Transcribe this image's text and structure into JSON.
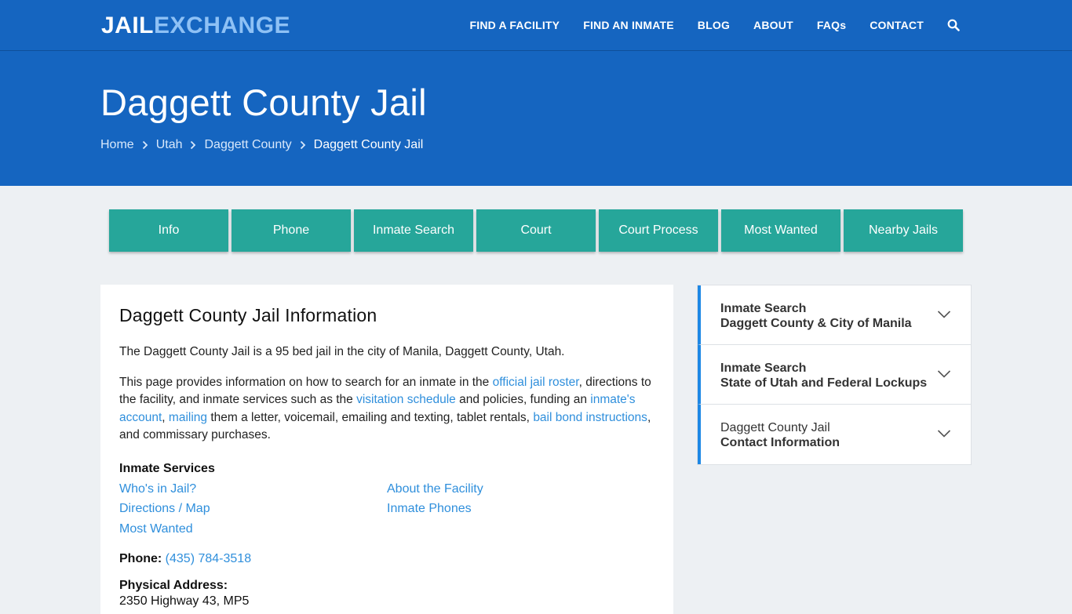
{
  "header": {
    "logo_part1": "JAIL",
    "logo_part2": "EXCHANGE",
    "nav": [
      "FIND A FACILITY",
      "FIND AN INMATE",
      "BLOG",
      "ABOUT",
      "FAQs",
      "CONTACT"
    ]
  },
  "hero": {
    "title": "Daggett County Jail",
    "breadcrumbs": [
      "Home",
      "Utah",
      "Daggett County",
      "Daggett County Jail"
    ]
  },
  "tabs": [
    "Info",
    "Phone",
    "Inmate Search",
    "Court",
    "Court Process",
    "Most Wanted",
    "Nearby Jails"
  ],
  "main": {
    "heading": "Daggett County Jail Information",
    "intro": "The Daggett County Jail is a 95 bed jail in the city of Manila, Daggett County, Utah.",
    "para": {
      "t1": "This page provides information on how to search for an inmate in the ",
      "l1": "official jail roster",
      "t2": ", directions to the facility, and inmate services such as the ",
      "l2": "visitation schedule",
      "t3": " and policies, funding an ",
      "l3": "inmate's account",
      "t4": ", ",
      "l4": "mailing",
      "t5": " them a letter, voicemail, emailing and texting, tablet rentals, ",
      "l5": "bail bond instructions",
      "t6": ", and commissary purchases."
    },
    "services_title": "Inmate Services",
    "services": [
      "Who's in Jail?",
      "About the Facility",
      "Directions / Map",
      "Inmate Phones",
      "Most Wanted"
    ],
    "phone_label": "Phone:",
    "phone_value": "(435) 784-3518",
    "address_label": "Physical Address:",
    "address_value": "2350 Highway 43, MP5"
  },
  "sidebar": [
    {
      "line1": "Inmate Search",
      "line2": "Daggett County & City of Manila"
    },
    {
      "line1": "Inmate Search",
      "line2": "State of Utah and Federal Lockups"
    },
    {
      "line1": "Daggett County Jail",
      "line2": "Contact Information"
    }
  ],
  "colors": {
    "brand_blue": "#1565c0",
    "tab_teal": "#26a69a",
    "link_blue": "#2f8fdc",
    "accent_border": "#1e88e5"
  }
}
